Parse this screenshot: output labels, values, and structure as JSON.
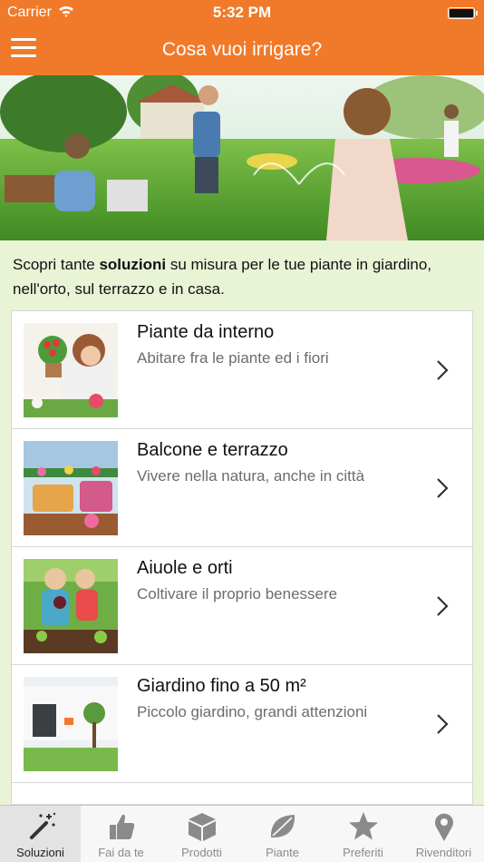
{
  "status_bar": {
    "carrier": "Carrier",
    "time": "5:32 PM"
  },
  "nav": {
    "title": "Cosa vuoi irrigare?"
  },
  "intro": {
    "prefix": "Scopri tante ",
    "bold": "soluzioni",
    "suffix": " su misura per le tue piante in giardino, nell'orto, sul terrazzo e in casa."
  },
  "items": [
    {
      "title": "Piante da interno",
      "subtitle": "Abitare fra le piante ed i fiori"
    },
    {
      "title": "Balcone e terrazzo",
      "subtitle": "Vivere nella natura, anche in città"
    },
    {
      "title": "Aiuole e orti",
      "subtitle": "Coltivare il proprio benessere"
    },
    {
      "title": "Giardino fino a 50 m²",
      "subtitle": "Piccolo giardino, grandi attenzioni"
    }
  ],
  "tabs": [
    {
      "label": "Soluzioni",
      "icon": "magic-wand-icon",
      "active": true
    },
    {
      "label": "Fai da te",
      "icon": "thumbs-up-icon",
      "active": false
    },
    {
      "label": "Prodotti",
      "icon": "box-icon",
      "active": false
    },
    {
      "label": "Piante",
      "icon": "leaf-icon",
      "active": false
    },
    {
      "label": "Preferiti",
      "icon": "star-icon",
      "active": false
    },
    {
      "label": "Rivenditori",
      "icon": "map-pin-icon",
      "active": false
    }
  ],
  "colors": {
    "header": "#f07a2a",
    "background": "#e9f3d6",
    "tab_active": "#e3e3e3",
    "icon_inactive": "#8a8a8a",
    "icon_active": "#333333"
  }
}
